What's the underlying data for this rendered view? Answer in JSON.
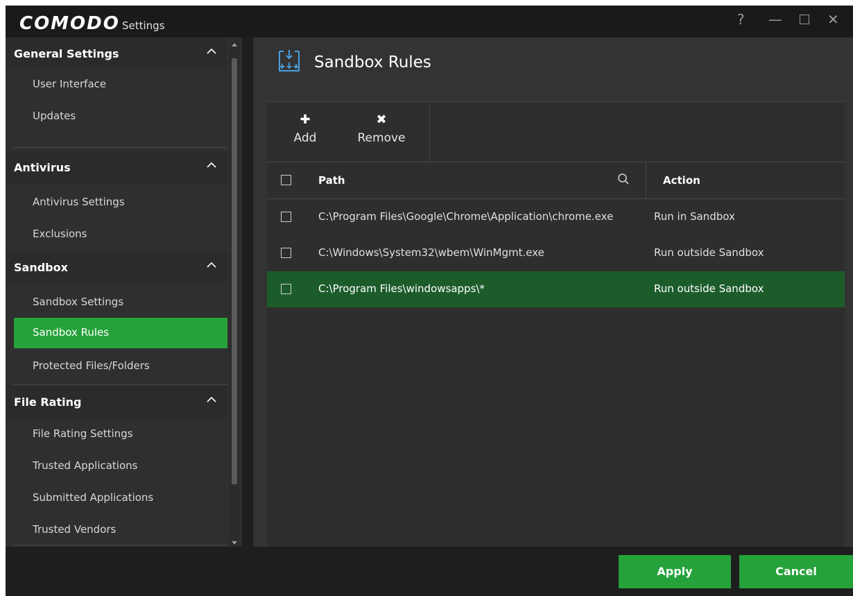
{
  "titlebar": {
    "brand": "COMODO",
    "subtitle": "Settings",
    "help_icon": "?",
    "minimize_icon": "—",
    "close_icon": "✕"
  },
  "sidebar": {
    "groups": [
      {
        "label": "General Settings",
        "items": [
          "User Interface",
          "Updates"
        ]
      },
      {
        "label": "Antivirus",
        "items": [
          "Antivirus Settings",
          "Exclusions"
        ]
      },
      {
        "label": "Sandbox",
        "items": [
          "Sandbox Settings",
          "Sandbox Rules",
          "Protected Files/Folders"
        ]
      },
      {
        "label": "File Rating",
        "items": [
          "File Rating Settings",
          "Trusted Applications",
          "Submitted Applications",
          "Trusted Vendors"
        ]
      }
    ],
    "active_item": "Sandbox Rules"
  },
  "main": {
    "title": "Sandbox Rules",
    "toolbar": {
      "add_symbol": "✚",
      "add_label": "Add",
      "remove_symbol": "✖",
      "remove_label": "Remove"
    },
    "table": {
      "columns": [
        "Path",
        "Action"
      ],
      "rows": [
        {
          "path": "C:\\Program Files\\Google\\Chrome\\Application\\chrome.exe",
          "action": "Run in Sandbox",
          "selected": false
        },
        {
          "path": "C:\\Windows\\System32\\wbem\\WinMgmt.exe",
          "action": "Run outside Sandbox",
          "selected": false
        },
        {
          "path": "C:\\Program Files\\windowsapps\\*",
          "action": "Run outside Sandbox",
          "selected": true
        }
      ]
    }
  },
  "footer": {
    "apply_label": "Apply",
    "cancel_label": "Cancel"
  },
  "colors": {
    "accent_green": "#26a23a",
    "selected_row": "#1c5c2b",
    "background": "#1e1e1e"
  }
}
